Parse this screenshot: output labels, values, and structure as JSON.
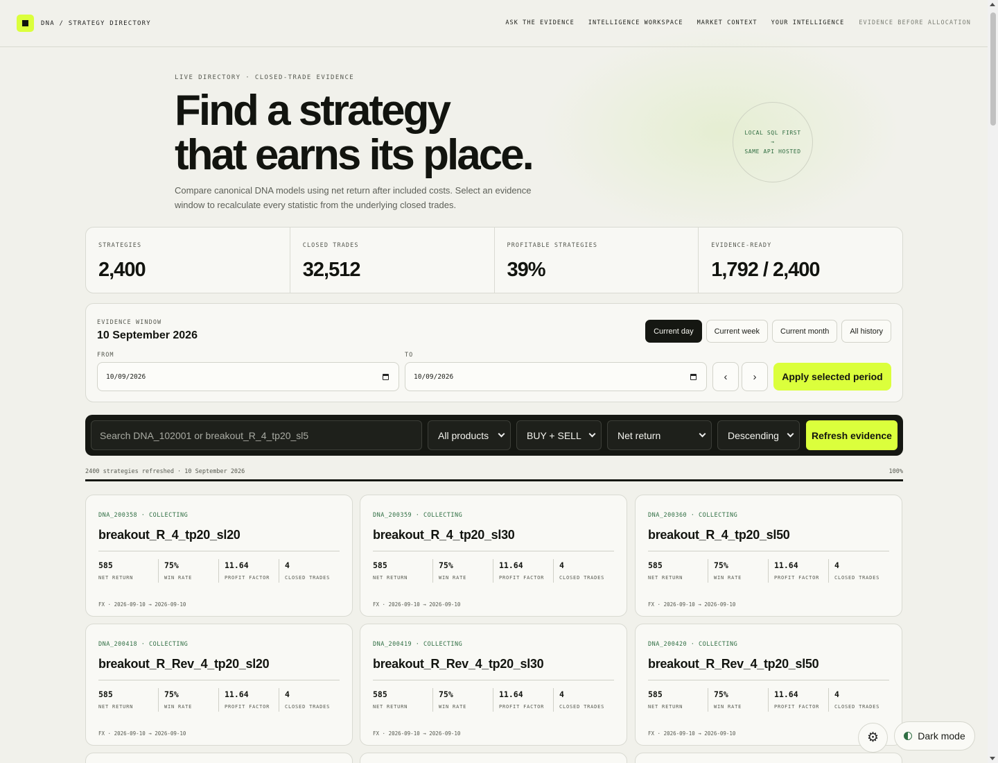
{
  "brand": {
    "text": "DNA / STRATEGY DIRECTORY"
  },
  "nav": {
    "links": [
      "ASK THE EVIDENCE",
      "INTELLIGENCE WORKSPACE",
      "MARKET CONTEXT",
      "YOUR INTELLIGENCE"
    ],
    "tagline": "EVIDENCE BEFORE ALLOCATION"
  },
  "hero": {
    "eyebrow": "LIVE DIRECTORY · CLOSED-TRADE EVIDENCE",
    "title_line1": "Find a strategy",
    "title_line2": "that earns its place.",
    "subtitle": "Compare canonical DNA models using net return after included costs. Select an evidence window to recalculate every statistic from the underlying closed trades.",
    "badge_line1": "LOCAL SQL FIRST",
    "badge_arrow": "→",
    "badge_line2": "SAME API HOSTED"
  },
  "stats": [
    {
      "label": "STRATEGIES",
      "value": "2,400"
    },
    {
      "label": "CLOSED TRADES",
      "value": "32,512"
    },
    {
      "label": "PROFITABLE STRATEGIES",
      "value": "39%"
    },
    {
      "label": "EVIDENCE-READY",
      "value": "1,792 / 2,400"
    }
  ],
  "window": {
    "label": "EVIDENCE WINDOW",
    "date": "10 September 2026",
    "periods": [
      "Current day",
      "Current week",
      "Current month",
      "All history"
    ],
    "active_period": "Current day",
    "from_label": "FROM",
    "from_value": "10/09/2026",
    "to_label": "TO",
    "to_value": "10/09/2026",
    "prev_label": "‹",
    "next_label": "›",
    "apply_label": "Apply selected period"
  },
  "search": {
    "placeholder": "Search DNA_102001 or breakout_R_4_tp20_sl5",
    "product": "All products",
    "side": "BUY + SELL",
    "sort": "Net return",
    "order": "Descending",
    "refresh_label": "Refresh evidence"
  },
  "progress": {
    "text": "2400 strategies refreshed · 10 September 2026",
    "percent_label": "100%",
    "fraction": 1.0
  },
  "metric_labels": [
    "NET RETURN",
    "WIN RATE",
    "PROFIT FACTOR",
    "CLOSED TRADES"
  ],
  "cards": [
    {
      "id": "DNA_200358 · COLLECTING",
      "name": "breakout_R_4_tp20_sl20",
      "metrics": [
        "585",
        "75%",
        "11.64",
        "4"
      ],
      "footer": "FX · 2026-09-10 → 2026-09-10"
    },
    {
      "id": "DNA_200359 · COLLECTING",
      "name": "breakout_R_4_tp20_sl30",
      "metrics": [
        "585",
        "75%",
        "11.64",
        "4"
      ],
      "footer": "FX · 2026-09-10 → 2026-09-10"
    },
    {
      "id": "DNA_200360 · COLLECTING",
      "name": "breakout_R_4_tp20_sl50",
      "metrics": [
        "585",
        "75%",
        "11.64",
        "4"
      ],
      "footer": "FX · 2026-09-10 → 2026-09-10"
    },
    {
      "id": "DNA_200418 · COLLECTING",
      "name": "breakout_R_Rev_4_tp20_sl20",
      "metrics": [
        "585",
        "75%",
        "11.64",
        "4"
      ],
      "footer": "FX · 2026-09-10 → 2026-09-10"
    },
    {
      "id": "DNA_200419 · COLLECTING",
      "name": "breakout_R_Rev_4_tp20_sl30",
      "metrics": [
        "585",
        "75%",
        "11.64",
        "4"
      ],
      "footer": "FX · 2026-09-10 → 2026-09-10"
    },
    {
      "id": "DNA_200420 · COLLECTING",
      "name": "breakout_R_Rev_4_tp20_sl50",
      "metrics": [
        "585",
        "75%",
        "11.64",
        "4"
      ],
      "footer": "FX · 2026-09-10 → 2026-09-10"
    }
  ],
  "floating": {
    "settings_icon": "gear-icon",
    "dark_mode_label": "Dark mode"
  },
  "colors": {
    "accent": "#dbff3c",
    "ink": "#151712",
    "background": "#f1f1eb",
    "status_green": "#2f6e43"
  }
}
